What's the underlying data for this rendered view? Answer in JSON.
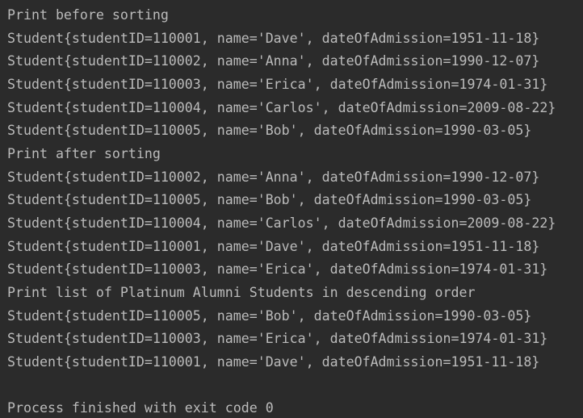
{
  "console": {
    "lines": [
      "Print before sorting",
      "Student{studentID=110001, name='Dave', dateOfAdmission=1951-11-18}",
      "Student{studentID=110002, name='Anna', dateOfAdmission=1990-12-07}",
      "Student{studentID=110003, name='Erica', dateOfAdmission=1974-01-31}",
      "Student{studentID=110004, name='Carlos', dateOfAdmission=2009-08-22}",
      "Student{studentID=110005, name='Bob', dateOfAdmission=1990-03-05}",
      "Print after sorting",
      "Student{studentID=110002, name='Anna', dateOfAdmission=1990-12-07}",
      "Student{studentID=110005, name='Bob', dateOfAdmission=1990-03-05}",
      "Student{studentID=110004, name='Carlos', dateOfAdmission=2009-08-22}",
      "Student{studentID=110001, name='Dave', dateOfAdmission=1951-11-18}",
      "Student{studentID=110003, name='Erica', dateOfAdmission=1974-01-31}",
      "Print list of Platinum Alumni Students in descending order",
      "Student{studentID=110005, name='Bob', dateOfAdmission=1990-03-05}",
      "Student{studentID=110003, name='Erica', dateOfAdmission=1974-01-31}",
      "Student{studentID=110001, name='Dave', dateOfAdmission=1951-11-18}",
      "",
      "Process finished with exit code 0"
    ]
  }
}
